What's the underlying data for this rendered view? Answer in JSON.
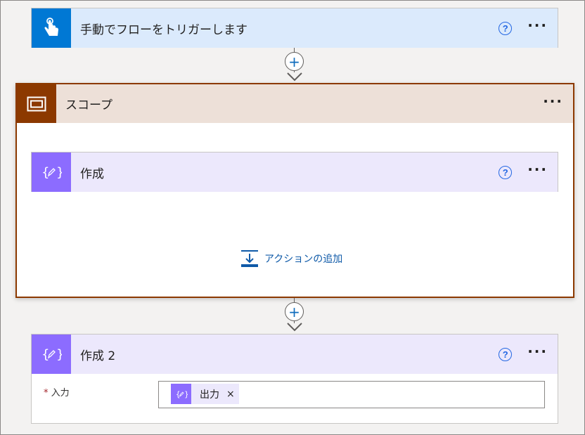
{
  "trigger": {
    "title": "手動でフローをトリガーします",
    "icon": "hand-touch-icon",
    "color": "#0078d4",
    "header_bg": "#dbeafc"
  },
  "scope": {
    "title": "スコープ",
    "icon": "scope-icon",
    "color": "#8c3900",
    "header_bg": "#ede0d8",
    "inner": {
      "title": "作成",
      "icon": "compose-icon",
      "color": "#8c6cff",
      "header_bg": "#ece8fc"
    },
    "add_action_label": "アクションの追加"
  },
  "compose2": {
    "title": "作成 2",
    "icon": "compose-icon",
    "color": "#8c6cff",
    "header_bg": "#ece8fc",
    "input_label": "入力",
    "required_mark": "*",
    "token_label": "出力",
    "token_remove": "×"
  },
  "help_glyph": "?",
  "more_glyph": "···",
  "plus_glyph": "+"
}
